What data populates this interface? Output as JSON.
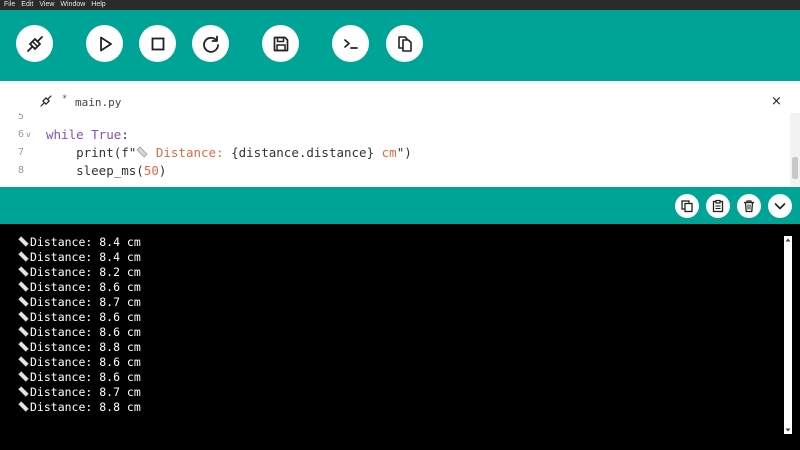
{
  "menu": {
    "items": [
      "File",
      "Edit",
      "View",
      "Window",
      "Help"
    ]
  },
  "toolbar": {
    "buttons": [
      {
        "name": "connect-button",
        "icon": "plug-icon"
      },
      {
        "name": "run-button",
        "icon": "play-icon"
      },
      {
        "name": "stop-button",
        "icon": "stop-icon"
      },
      {
        "name": "reset-button",
        "icon": "reload-icon"
      },
      {
        "name": "save-button",
        "icon": "floppy-disk-icon"
      },
      {
        "name": "terminal-button",
        "icon": "terminal-icon"
      },
      {
        "name": "files-button",
        "icon": "files-icon"
      }
    ]
  },
  "editor": {
    "tab": {
      "modified_marker": "*",
      "filename": "main.py",
      "close_glyph": "×"
    },
    "lines": [
      {
        "number": "5",
        "fold": "",
        "segments": []
      },
      {
        "number": "6",
        "fold": "v",
        "segments": [
          {
            "text": "while ",
            "style": "kw"
          },
          {
            "text": "True",
            "style": "kw"
          },
          {
            "text": ":",
            "style": "plain"
          }
        ]
      },
      {
        "number": "7",
        "fold": "",
        "segments": [
          {
            "text": "    print(f\"",
            "style": "plain"
          },
          {
            "text": "📏",
            "style": "emoji"
          },
          {
            "text": " Distance: ",
            "style": "str"
          },
          {
            "text": "{distance.distance}",
            "style": "plain"
          },
          {
            "text": " cm",
            "style": "str"
          },
          {
            "text": "\")",
            "style": "plain"
          }
        ]
      },
      {
        "number": "8",
        "fold": "",
        "segments": [
          {
            "text": "    sleep_ms(",
            "style": "plain"
          },
          {
            "text": "50",
            "style": "num"
          },
          {
            "text": ")",
            "style": "plain"
          }
        ]
      }
    ]
  },
  "console_header": {
    "buttons": [
      {
        "name": "copy-button",
        "icon": "copy-icon"
      },
      {
        "name": "paste-button",
        "icon": "clipboard-icon"
      },
      {
        "name": "clear-button",
        "icon": "trash-icon"
      },
      {
        "name": "collapse-button",
        "icon": "chevron-down-icon"
      }
    ]
  },
  "console": {
    "lines": [
      "Distance: 8.4 cm",
      "Distance: 8.4 cm",
      "Distance: 8.2 cm",
      "Distance: 8.6 cm",
      "Distance: 8.7 cm",
      "Distance: 8.6 cm",
      "Distance: 8.6 cm",
      "Distance: 8.8 cm",
      "Distance: 8.6 cm",
      "Distance: 8.6 cm",
      "Distance: 8.7 cm",
      "Distance: 8.8 cm"
    ]
  },
  "colors": {
    "accent": "#00a496",
    "keyword": "#8a4fb4",
    "string": "#e0694a",
    "menubar": "#2b2b2b",
    "console_bg": "#000000"
  }
}
